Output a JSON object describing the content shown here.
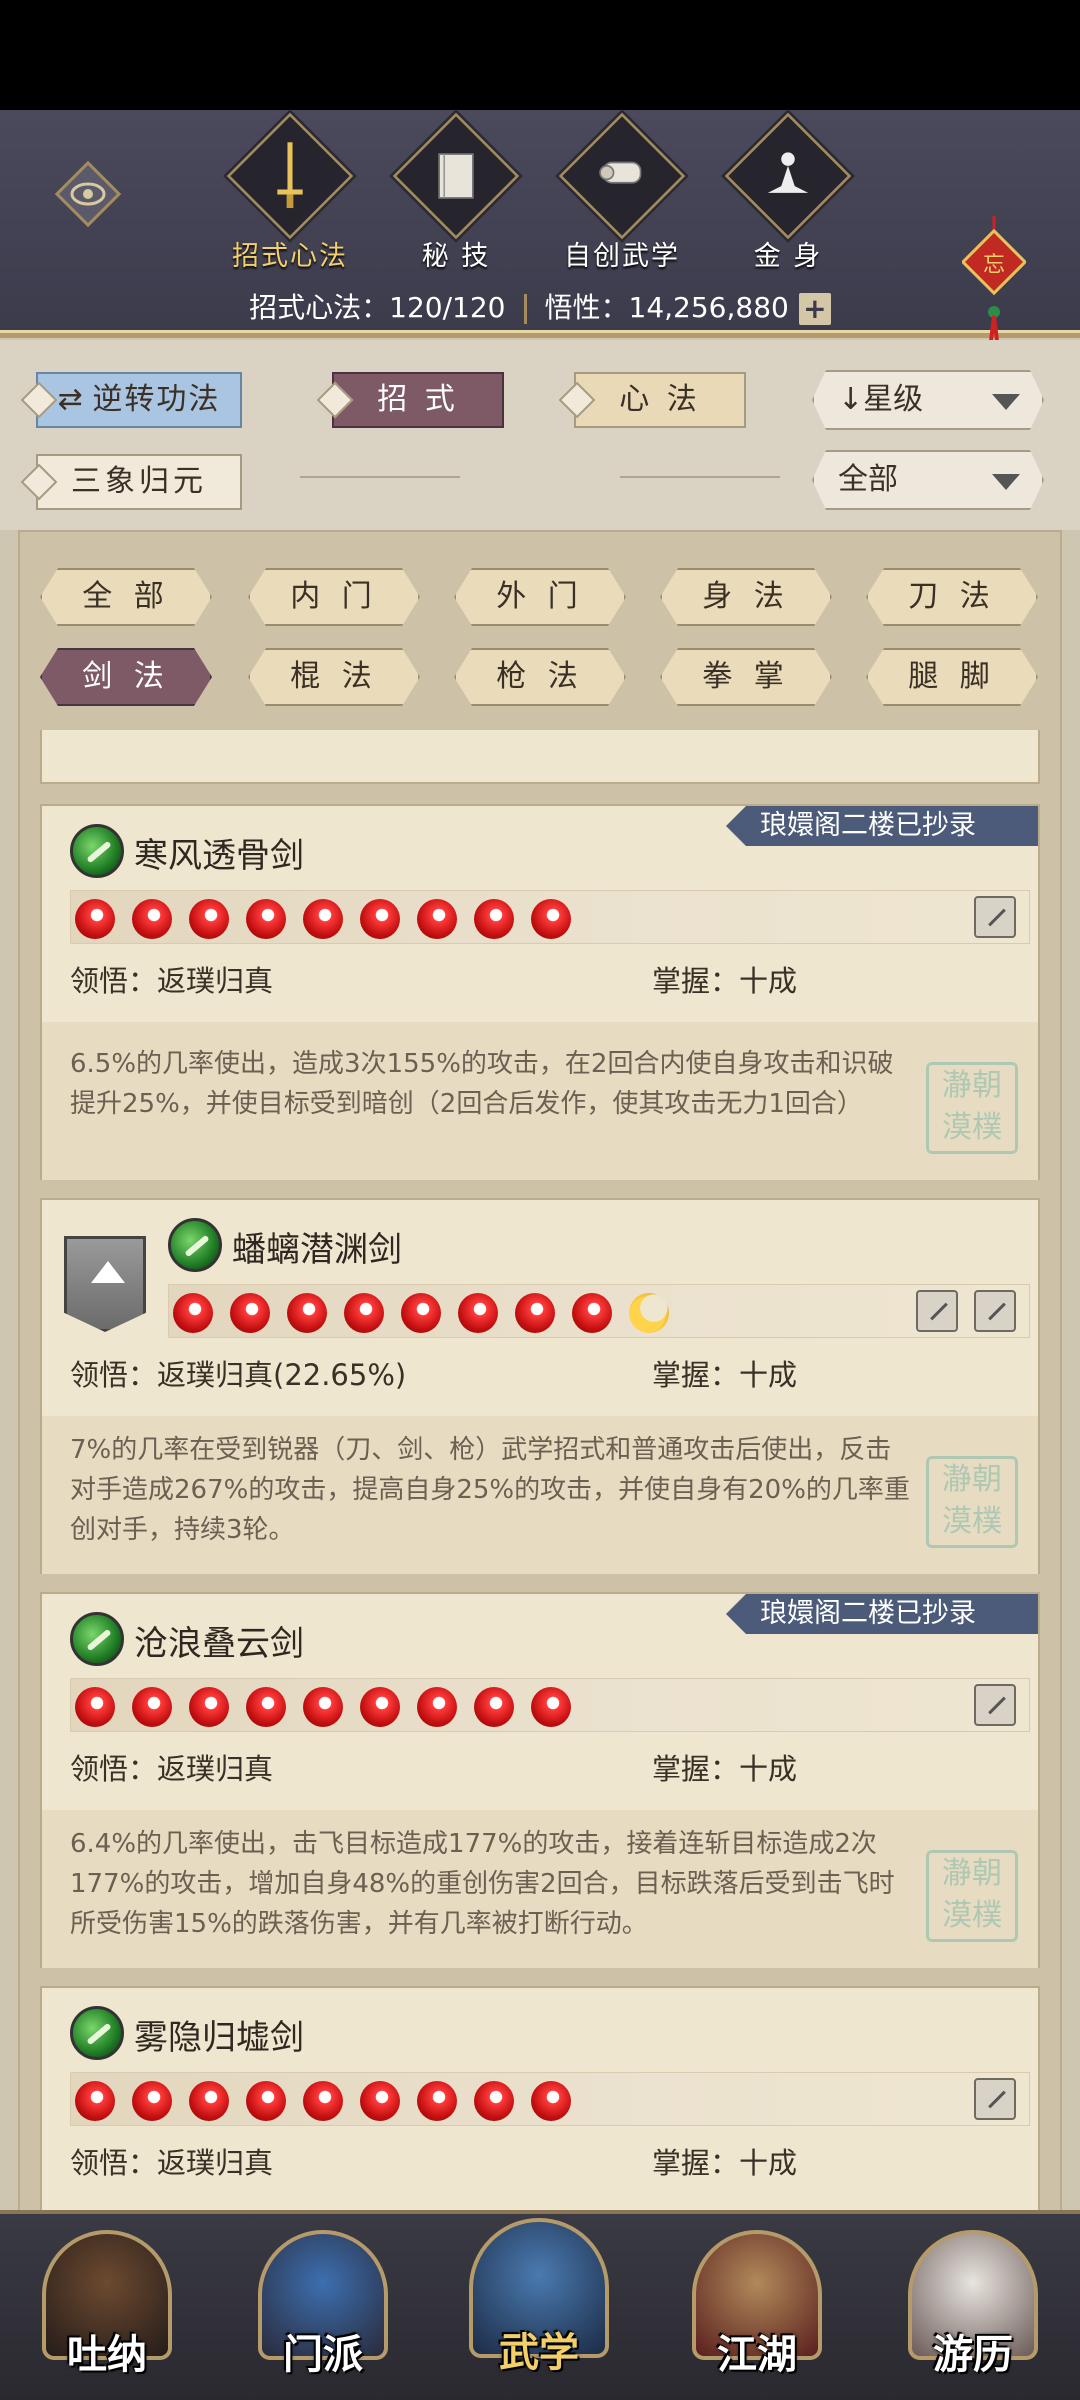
{
  "top_tabs": [
    {
      "label": "招式心法",
      "icon": "sword-icon",
      "active": true
    },
    {
      "label": "秘 技",
      "icon": "book-icon",
      "active": false
    },
    {
      "label": "自创武学",
      "icon": "scroll-icon",
      "active": false
    },
    {
      "label": "金 身",
      "icon": "meditation-icon",
      "active": false
    }
  ],
  "header": {
    "moves_label": "招式心法：120/120",
    "insight_label": "悟性：14,256,880",
    "plus": "+",
    "charm_char": "忘"
  },
  "filters": {
    "reverse_button": "逆转功法",
    "moves_tab": "招 式",
    "heart_tab": "心 法",
    "sort_dropdown": "星级",
    "sanxiang_button": "三象归元",
    "scope_dropdown": "全部"
  },
  "categories": [
    "全 部",
    "内 门",
    "外 门",
    "身 法",
    "刀 法",
    "剑 法",
    "棍 法",
    "枪 法",
    "拳 掌",
    "腿 脚"
  ],
  "selected_category": "剑 法",
  "skills": [
    {
      "name": "寒风透骨剑",
      "badge": "琅嬛阁二楼已抄录",
      "stars": 9,
      "half_star": false,
      "comprehension": "领悟：返璞归真",
      "mastery": "掌握：十成",
      "description": [
        "6.5%的几率使出，造成3次155%的攻击，在2回合内使自身攻击和识破",
        "提升25%，并使目标受到暗创（2回合后发作，使其攻击无力1回合）"
      ]
    },
    {
      "name": "蟠螭潜渊剑",
      "badge": "",
      "stars": 8,
      "half_star": true,
      "comprehension": "领悟：返璞归真(22.65%)",
      "mastery": "掌握：十成",
      "description": [
        "7%的几率在受到锐器（刀、剑、枪）武学招式和普通攻击后使出，反击",
        "对手造成267%的攻击，提高自身25%的攻击，并使自身有20%的几率重",
        "创对手，持续3轮。"
      ]
    },
    {
      "name": "沧浪叠云剑",
      "badge": "琅嬛阁二楼已抄录",
      "stars": 9,
      "half_star": false,
      "comprehension": "领悟：返璞归真",
      "mastery": "掌握：十成",
      "description": [
        "6.4%的几率使出，击飞目标造成177%的攻击，接着连斩目标造成2次",
        "177%的攻击，增加自身48%的重创伤害2回合，目标跌落后受到击飞时",
        "所受伤害15%的跌落伤害，并有几率被打断行动。"
      ]
    },
    {
      "name": "雾隐归墟剑",
      "badge": "",
      "stars": 9,
      "half_star": false,
      "comprehension": "领悟：返璞归真",
      "mastery": "掌握：十成",
      "description": []
    }
  ],
  "seal_text": [
    "瀞",
    "朝",
    "漠",
    "樸"
  ],
  "bottom_nav": [
    {
      "label": "吐纳",
      "active": false
    },
    {
      "label": "门派",
      "active": false
    },
    {
      "label": "武学",
      "active": true
    },
    {
      "label": "江湖",
      "active": false
    },
    {
      "label": "游历",
      "active": false
    }
  ],
  "colors": {
    "accent": "#f2cf6b",
    "badge": "#4d5b7a",
    "selected_tab": "#7e5a66",
    "star_red": "#c30f10"
  }
}
